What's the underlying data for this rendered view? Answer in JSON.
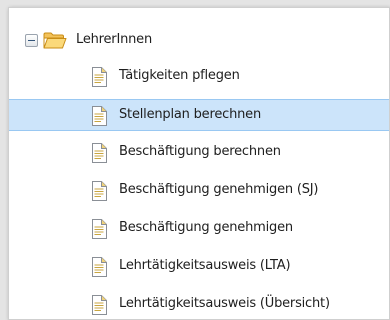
{
  "tree": {
    "parent": {
      "label": "LehrerInnen",
      "icon": "folder-open-icon",
      "toggle_icon": "collapse-minus-icon"
    },
    "selected_index": 1,
    "items": [
      {
        "label": "Tätigkeiten pflegen",
        "icon": "document-icon"
      },
      {
        "label": "Stellenplan berechnen",
        "icon": "document-icon"
      },
      {
        "label": "Beschäftigung berechnen",
        "icon": "document-icon"
      },
      {
        "label": "Beschäftigung genehmigen (SJ)",
        "icon": "document-icon"
      },
      {
        "label": "Beschäftigung genehmigen",
        "icon": "document-icon"
      },
      {
        "label": "Lehrtätigkeitsausweis (LTA)",
        "icon": "document-icon"
      },
      {
        "label": "Lehrtätigkeitsausweis (Übersicht)",
        "icon": "document-icon"
      }
    ]
  },
  "colors": {
    "selection_bg": "#cce4fa",
    "selection_border": "#99c8f2",
    "folder": "#f5c55a",
    "document": "#ffffff",
    "document_fold": "#f0d27a"
  }
}
